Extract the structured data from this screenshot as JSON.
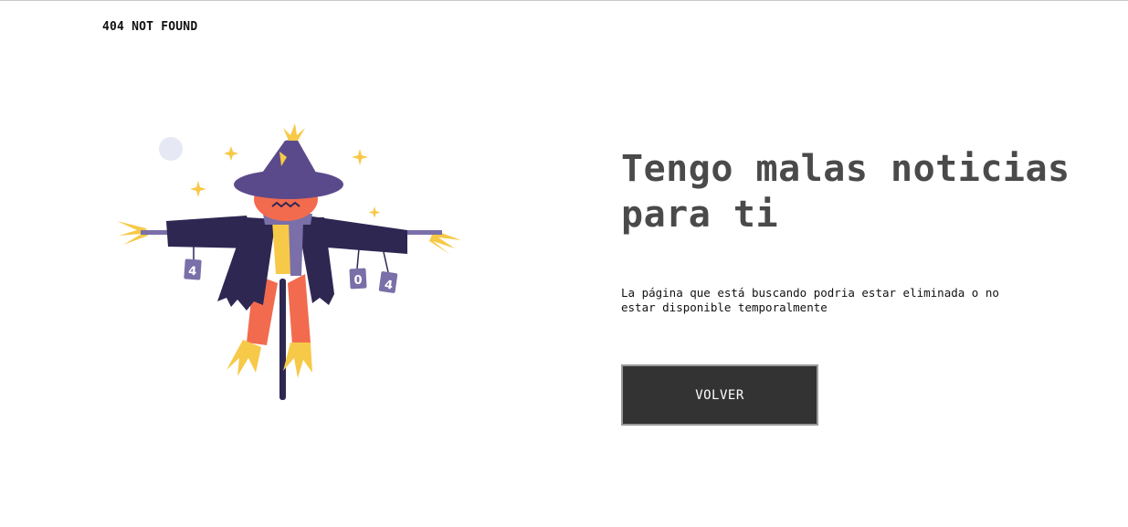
{
  "header": {
    "brand": "404 NOT FOUND"
  },
  "illustration": {
    "name": "scarecrow-illustration",
    "can_labels": [
      "4",
      "0",
      "4"
    ]
  },
  "main": {
    "headline": "Tengo malas noticias para ti",
    "message": "La página que está buscando podria estar eliminada o no estar disponible temporalmente",
    "button_label": "VOLVER"
  },
  "colors": {
    "hat": "#5b4a8b",
    "coat": "#2e2752",
    "pumpkin": "#f26b4f",
    "straw": "#f7c948",
    "scarf": "#7a6fa8",
    "button_bg": "#333333",
    "headline": "#4a4a4a"
  }
}
